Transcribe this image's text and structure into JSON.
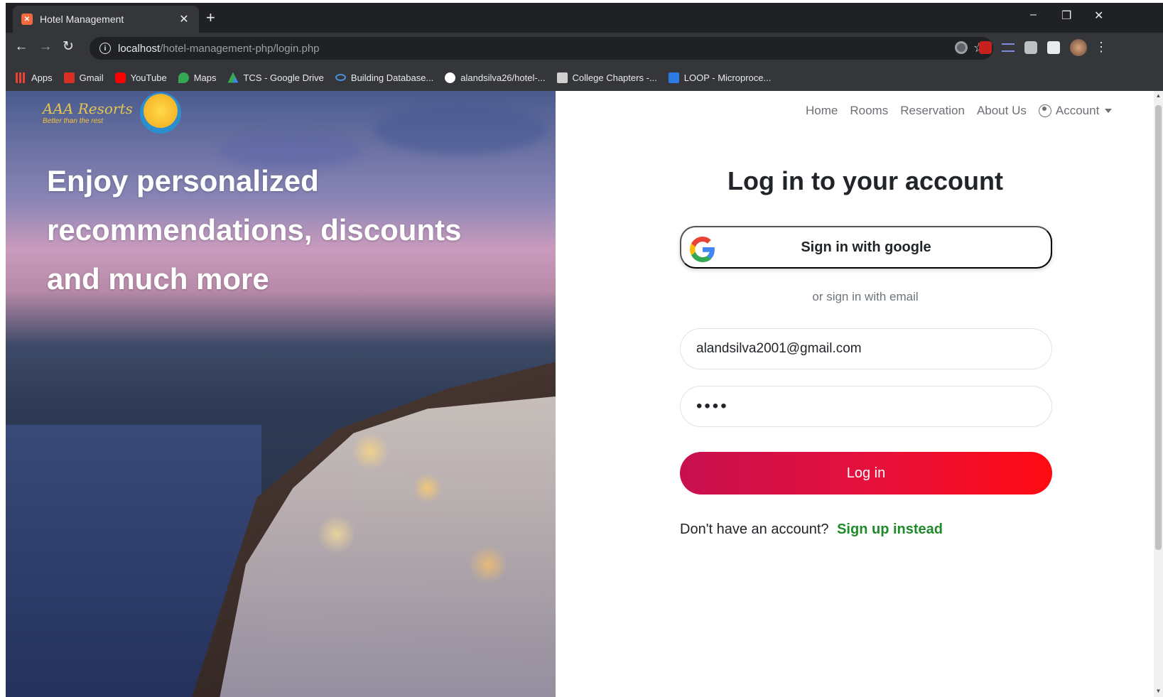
{
  "browser": {
    "tab_title": "Hotel Management",
    "url_host": "localhost",
    "url_path": "/hotel-management-php/login.php",
    "bookmarks": [
      {
        "label": "Apps",
        "icon": "apps-grid-icon",
        "color": "#ea4335"
      },
      {
        "label": "Gmail",
        "icon": "gmail-icon",
        "color": "#d93025"
      },
      {
        "label": "YouTube",
        "icon": "youtube-icon",
        "color": "#ff0000"
      },
      {
        "label": "Maps",
        "icon": "maps-pin-icon",
        "color": "#34a853"
      },
      {
        "label": "TCS - Google Drive",
        "icon": "drive-icon",
        "color": "#fbbc04"
      },
      {
        "label": "Building Database...",
        "icon": "infinity-icon",
        "color": "#4a90d9"
      },
      {
        "label": "alandsilva26/hotel-...",
        "icon": "github-icon",
        "color": "#ffffff"
      },
      {
        "label": "College Chapters -...",
        "icon": "cc-icon",
        "color": "#d0d0d0"
      },
      {
        "label": "LOOP - Microproce...",
        "icon": "trello-icon",
        "color": "#2c7be5"
      }
    ]
  },
  "hero": {
    "logo_name": "AAA Resorts",
    "logo_tagline": "Better than the rest",
    "headline_line1": "Enjoy personalized",
    "headline_line2": "recommendations, discounts",
    "headline_line3": "and much more"
  },
  "nav": {
    "items": [
      "Home",
      "Rooms",
      "Reservation",
      "About Us"
    ],
    "account_label": "Account"
  },
  "form": {
    "title": "Log in to your account",
    "google_button": "Sign in with google",
    "or_text": "or sign in with email",
    "email_value": "alandsilva2001@gmail.com",
    "password_value": "••••",
    "login_button": "Log in",
    "signup_prompt": "Don't have an account?",
    "signup_link": "Sign up instead"
  },
  "colors": {
    "login_gradient_start": "#c8104f",
    "login_gradient_end": "#ff0a12",
    "signup_link": "#1e8a2a"
  }
}
